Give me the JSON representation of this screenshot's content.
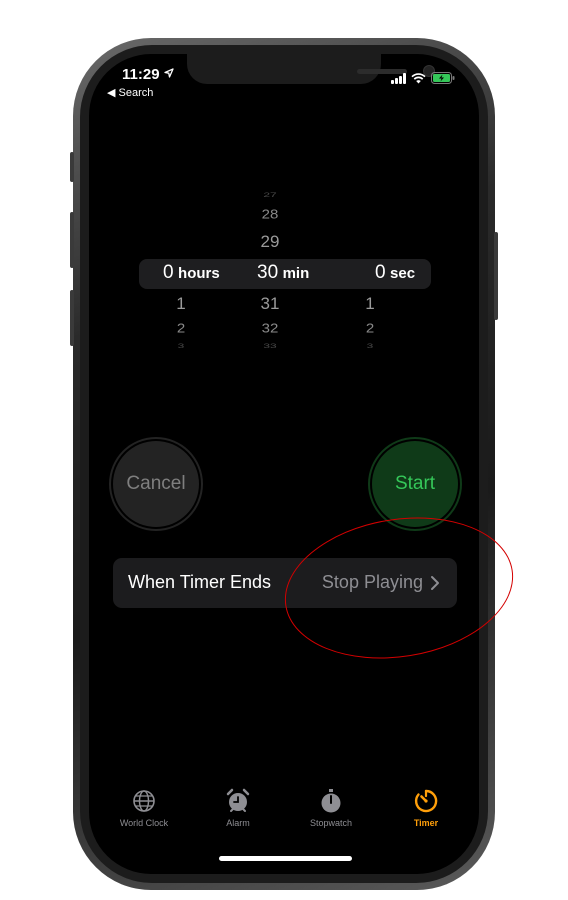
{
  "status_bar": {
    "time": "11:29",
    "back_label": "Search"
  },
  "picker": {
    "hours": {
      "above": [],
      "selected": "0",
      "unit": "hours",
      "below": [
        "1",
        "2",
        "3"
      ]
    },
    "minutes": {
      "above": [
        "27",
        "28",
        "29"
      ],
      "selected": "30",
      "unit": "min",
      "below": [
        "31",
        "32",
        "33"
      ]
    },
    "seconds": {
      "above": [],
      "selected": "0",
      "unit": "sec",
      "below": [
        "1",
        "2",
        "3"
      ]
    }
  },
  "buttons": {
    "cancel": "Cancel",
    "start": "Start"
  },
  "timer_ends": {
    "label": "When Timer Ends",
    "value": "Stop Playing"
  },
  "tabbar": {
    "tabs": [
      {
        "label": "World Clock",
        "icon": "globe-icon",
        "active": false
      },
      {
        "label": "Alarm",
        "icon": "alarm-clock-icon",
        "active": false
      },
      {
        "label": "Stopwatch",
        "icon": "stopwatch-icon",
        "active": false
      },
      {
        "label": "Timer",
        "icon": "timer-icon",
        "active": true
      }
    ]
  },
  "colors": {
    "accent_orange": "#ff9f0a",
    "start_green": "#35c759",
    "annotation_red": "#d40000",
    "inactive_gray": "#8e8e93"
  }
}
